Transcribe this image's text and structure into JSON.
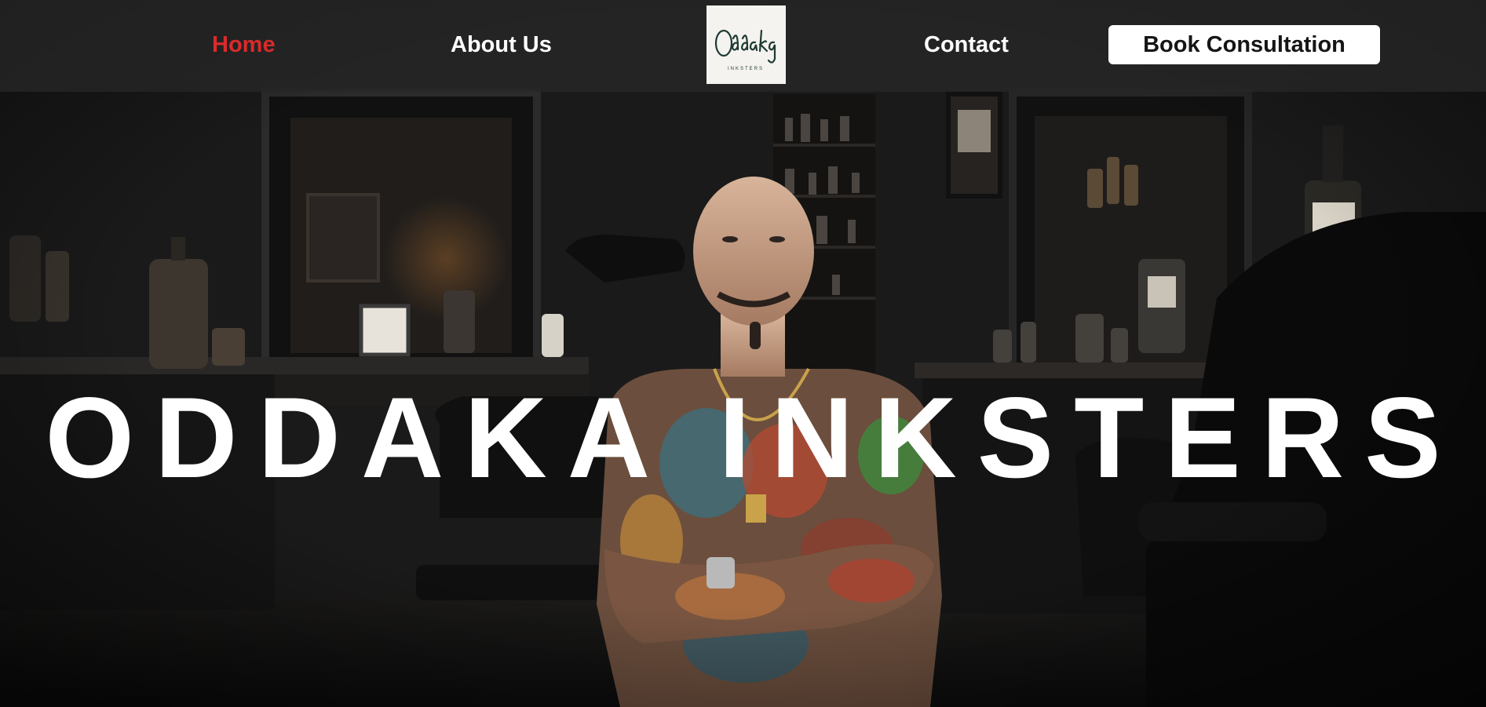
{
  "nav": {
    "links": [
      {
        "label": "Home",
        "active": true
      },
      {
        "label": "About Us",
        "active": false
      },
      {
        "label": "Contact",
        "active": false
      }
    ],
    "cta_label": "Book Consultation",
    "logo": {
      "script_text": "Oddaka",
      "sub_text": "INKSTERS"
    }
  },
  "hero": {
    "title": "ODDAKA INKSTERS",
    "image": "tattoo-artist-studio-photo"
  },
  "colors": {
    "accent": "#d82b2b",
    "nav_text": "#ffffff",
    "cta_background": "#ffffff",
    "cta_text": "#151515",
    "logo_ink": "#1f3a33"
  }
}
